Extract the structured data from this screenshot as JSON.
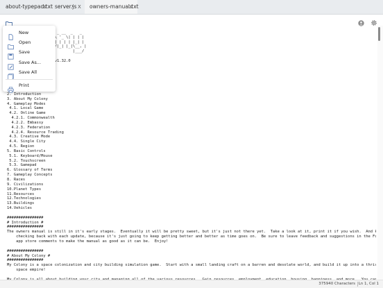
{
  "tabs": [
    {
      "label": "about-typepad.txt",
      "close": "X",
      "active": false,
      "modified": ""
    },
    {
      "label": "server.js",
      "close": "X",
      "active": false,
      "modified": "•"
    },
    {
      "label": "owners-manual.txt",
      "close": "X",
      "active": true,
      "modified": ""
    }
  ],
  "toolbar": {
    "icons": [
      "folder-icon",
      "avatar-icon",
      "gear-icon"
    ]
  },
  "menu": {
    "items": [
      {
        "label": "New",
        "icon": "new-file-icon"
      },
      {
        "label": "Open",
        "icon": "open-file-icon"
      },
      {
        "label": "Save",
        "icon": "save-icon"
      },
      {
        "label": "Save As...",
        "icon": "save-as-icon"
      },
      {
        "label": "Save All",
        "icon": "save-all-icon"
      },
      {
        "label": "Print",
        "icon": "print-icon"
      }
    ]
  },
  "editor": {
    "visible_text": "                 _\n        ___  __| |___ _ __  _   _\n       / __|/ _  / _ \\ '_ \\| | | |\n      | (__| (_| (_) | | | | |_| |\n       \\___|\\___,\\___/|_| |_|\\__, |\n                             |___/\n\n                  al v1.32.0\n\n\n\n\n\n\n2. Introduction\n3. About My Colony\n4. Gameplay Modes\n 4.1. Local Game\n 4.2. Online Game\n  4.2.1. Commonwealth\n  4.2.2. Embassy\n  4.2.3. Federation\n  4.2.4. Resource Trading\n 4.3. Creative Mode\n 4.4. Single City\n 4.5. Region\n5. Basic Controls\n 5.1. Keyboard/Mouse\n 5.2. Touchscreen\n 5.3. Gamepad\n6. Glossary of Terms\n7. Gameplay Concepts\n8. Races\n9. Civilizations\n10.Planet Types\n11.Resources\n12.Technologies\n13.Buildings\n14.Vehicles\n\n################\n# Introduction #\n################\nThe owners manual is still in it's early stages.  Eventually it will be pretty sweet, but it's just not there yet.  Take a look at it, print it if you wish.  And keep\n    checking back with each update, because it's just going to keep getting better and better as time goes on.  Be sure to leave feedback and suggestions in the Forum or\n    app store comments to make the manual as good as it can be.  Enjoy!\n\n################\n# About My Colony #\n################\nMy Colony is a space colonization and city building simulation game.  Start with a small landing craft on a barren and desolate world, and build it up into a thriving\n    space empire!\n\nMy Colony is all about building your city and managing all of the various resources.  Gain resources, employment, education, housing, happiness, and more.  You can start as"
  },
  "status": {
    "characters": "375940 Characters",
    "position": "Ln 1, Col 1"
  }
}
